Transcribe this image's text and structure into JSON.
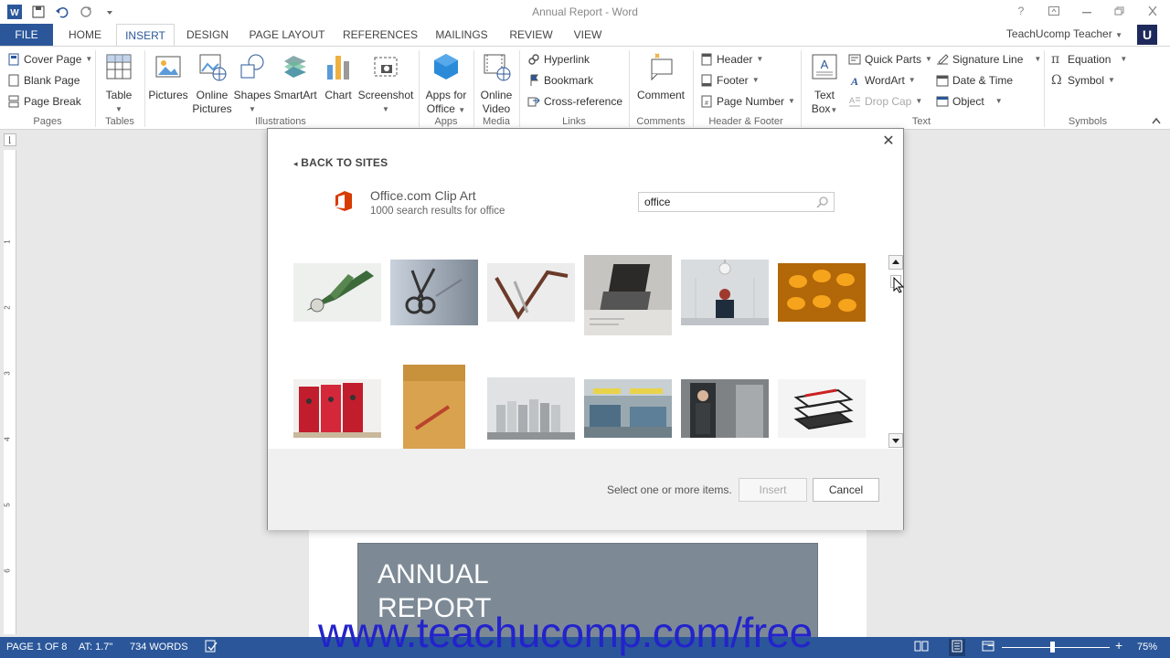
{
  "app": {
    "window_title": "Annual Report - Word"
  },
  "quick_access": {
    "icons": [
      "word-logo-icon",
      "save-icon",
      "undo-icon",
      "redo-icon",
      "customize-icon"
    ]
  },
  "tabs": [
    {
      "label": "FILE"
    },
    {
      "label": "HOME"
    },
    {
      "label": "INSERT"
    },
    {
      "label": "DESIGN"
    },
    {
      "label": "PAGE LAYOUT"
    },
    {
      "label": "REFERENCES"
    },
    {
      "label": "MAILINGS"
    },
    {
      "label": "REVIEW"
    },
    {
      "label": "VIEW"
    }
  ],
  "user": {
    "name": "TeachUcomp Teacher",
    "avatar": "U"
  },
  "ribbon": {
    "pages": {
      "label": "Pages",
      "cover_page": "Cover Page",
      "blank_page": "Blank Page",
      "page_break": "Page Break"
    },
    "tables": {
      "label": "Tables",
      "table": "Table"
    },
    "illustrations": {
      "label": "Illustrations",
      "pictures": "Pictures",
      "online_pictures_1": "Online",
      "online_pictures_2": "Pictures",
      "shapes": "Shapes",
      "smartart": "SmartArt",
      "chart": "Chart",
      "screenshot": "Screenshot"
    },
    "apps": {
      "label": "Apps",
      "apps_1": "Apps for",
      "apps_2": "Office"
    },
    "media": {
      "label": "Media",
      "video_1": "Online",
      "video_2": "Video"
    },
    "links": {
      "label": "Links",
      "hyperlink": "Hyperlink",
      "bookmark": "Bookmark",
      "cross_reference": "Cross-reference"
    },
    "comments": {
      "label": "Comments",
      "comment": "Comment"
    },
    "header_footer": {
      "label": "Header & Footer",
      "header": "Header",
      "footer": "Footer",
      "page_number": "Page Number"
    },
    "text": {
      "label": "Text",
      "text_box_1": "Text",
      "text_box_2": "Box",
      "quick_parts": "Quick Parts",
      "wordart": "WordArt",
      "drop_cap": "Drop Cap",
      "signature_line": "Signature Line",
      "date_time": "Date & Time",
      "object": "Object"
    },
    "symbols": {
      "label": "Symbols",
      "equation": "Equation",
      "symbol": "Symbol"
    }
  },
  "ruler": {
    "numbers": [
      "1",
      "2",
      "3",
      "4",
      "5",
      "6"
    ]
  },
  "dialog": {
    "back_link": "BACK TO SITES",
    "source_title": "Office.com Clip Art",
    "source_subtitle": "1000 search results for office",
    "search_value": "office",
    "status_message": "Select one or more items.",
    "insert_label": "Insert",
    "cancel_label": "Cancel",
    "results": [
      {
        "name": "green-paperclip-image"
      },
      {
        "name": "scissors-image"
      },
      {
        "name": "pen-chart-image"
      },
      {
        "name": "laptop-desk-image"
      },
      {
        "name": "person-lamp-image"
      },
      {
        "name": "orange-abacus-image"
      },
      {
        "name": "red-binders-image"
      },
      {
        "name": "confidential-folder-image"
      },
      {
        "name": "bookshelf-image"
      },
      {
        "name": "office-room-image"
      },
      {
        "name": "man-in-doorway-image"
      },
      {
        "name": "wire-tray-image"
      }
    ]
  },
  "document": {
    "cover_line1": "ANNUAL",
    "cover_line2": "REPORT"
  },
  "statusbar": {
    "page": "PAGE 1 OF 8",
    "at": "AT: 1.7\"",
    "words": "734 WORDS",
    "zoom": "75%",
    "zoom_level": 0.47
  },
  "watermark": "www.teachucomp.com/free",
  "colors": {
    "accent": "#2b579a",
    "office_orange": "#d83b01"
  }
}
